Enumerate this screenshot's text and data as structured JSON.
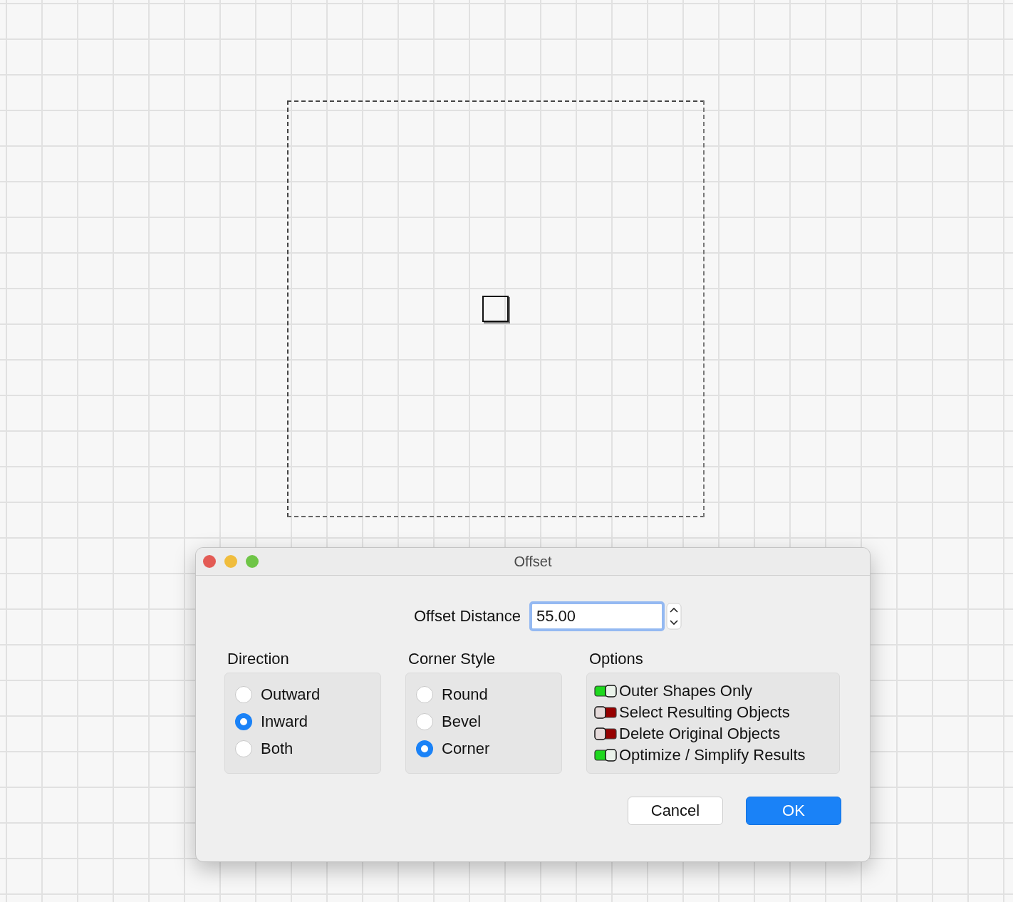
{
  "window": {
    "title": "Offset"
  },
  "offset_distance": {
    "label": "Offset Distance",
    "value": "55.00"
  },
  "direction": {
    "title": "Direction",
    "options": [
      {
        "label": "Outward",
        "selected": false
      },
      {
        "label": "Inward",
        "selected": true
      },
      {
        "label": "Both",
        "selected": false
      }
    ]
  },
  "corner_style": {
    "title": "Corner Style",
    "options": [
      {
        "label": "Round",
        "selected": false
      },
      {
        "label": "Bevel",
        "selected": false
      },
      {
        "label": "Corner",
        "selected": true
      }
    ]
  },
  "options": {
    "title": "Options",
    "items": [
      {
        "label": "Outer Shapes Only",
        "on": true
      },
      {
        "label": "Select Resulting Objects",
        "on": false
      },
      {
        "label": "Delete Original Objects",
        "on": false
      },
      {
        "label": "Optimize / Simplify Results",
        "on": true
      }
    ]
  },
  "buttons": [
    {
      "label": "Cancel",
      "kind": "secondary"
    },
    {
      "label": "OK",
      "kind": "primary"
    }
  ]
}
